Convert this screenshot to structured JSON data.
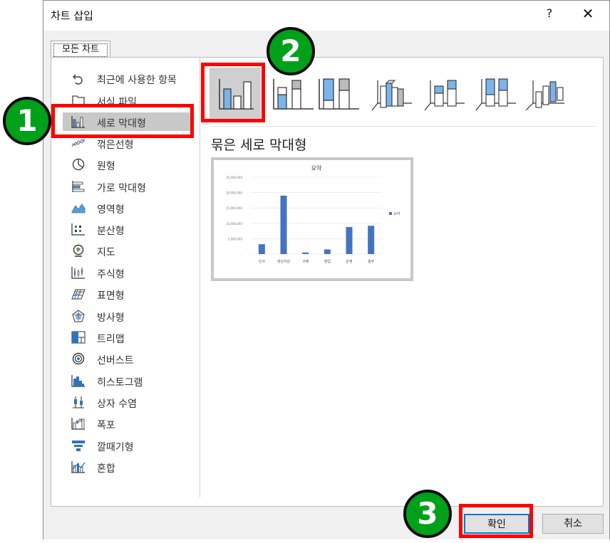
{
  "dialog": {
    "title": "차트 삽입",
    "help_label": "?",
    "close_label": "✕"
  },
  "tabs": [
    {
      "label": "모든 차트"
    }
  ],
  "categories": [
    {
      "label": "최근에 사용한 항목",
      "icon": "recent-icon"
    },
    {
      "label": "서식 파일",
      "icon": "folder-icon"
    },
    {
      "label": "세로 막대형",
      "icon": "column-chart-icon",
      "selected": true
    },
    {
      "label": "꺾은선형",
      "icon": "line-chart-icon"
    },
    {
      "label": "원형",
      "icon": "pie-chart-icon"
    },
    {
      "label": "가로 막대형",
      "icon": "bar-chart-icon"
    },
    {
      "label": "영역형",
      "icon": "area-chart-icon"
    },
    {
      "label": "분산형",
      "icon": "scatter-chart-icon"
    },
    {
      "label": "지도",
      "icon": "map-chart-icon"
    },
    {
      "label": "주식형",
      "icon": "stock-chart-icon"
    },
    {
      "label": "표면형",
      "icon": "surface-chart-icon"
    },
    {
      "label": "방사형",
      "icon": "radar-chart-icon"
    },
    {
      "label": "트리맵",
      "icon": "treemap-chart-icon"
    },
    {
      "label": "선버스트",
      "icon": "sunburst-chart-icon"
    },
    {
      "label": "히스토그램",
      "icon": "histogram-chart-icon"
    },
    {
      "label": "상자 수염",
      "icon": "box-whisker-chart-icon"
    },
    {
      "label": "폭포",
      "icon": "waterfall-chart-icon"
    },
    {
      "label": "깔때기형",
      "icon": "funnel-chart-icon"
    },
    {
      "label": "혼합",
      "icon": "combo-chart-icon"
    }
  ],
  "subtypes": [
    {
      "icon": "clustered-column-icon",
      "selected": true
    },
    {
      "icon": "stacked-column-icon"
    },
    {
      "icon": "100-stacked-column-icon"
    },
    {
      "icon": "3d-clustered-column-icon"
    },
    {
      "icon": "3d-stacked-column-icon"
    },
    {
      "icon": "3d-100-stacked-column-icon"
    },
    {
      "icon": "3d-column-icon"
    }
  ],
  "selected_subtype_title": "묶은 세로 막대형",
  "chart_data": {
    "type": "bar",
    "title": "요약",
    "categories": [
      "인사",
      "생산지원",
      "구매",
      "영업",
      "운영",
      "총무"
    ],
    "series": [
      {
        "name": "요약",
        "values": [
          3200000,
          19000000,
          500000,
          1500000,
          8800000,
          9200000
        ]
      }
    ],
    "ylim": [
      0,
      25000000
    ],
    "yticks": [
      "-",
      "5,000,000",
      "10,000,000",
      "15,000,000",
      "20,000,000",
      "25,000,000"
    ],
    "legend": "right",
    "grid": true,
    "bar_color": "#4472c4"
  },
  "buttons": {
    "ok_label": "확인",
    "cancel_label": "취소"
  },
  "annotations": {
    "badge1": "1",
    "badge2": "2",
    "badge3": "3",
    "highlight_color": "#ff0000",
    "badge_color": "#00a11a"
  }
}
